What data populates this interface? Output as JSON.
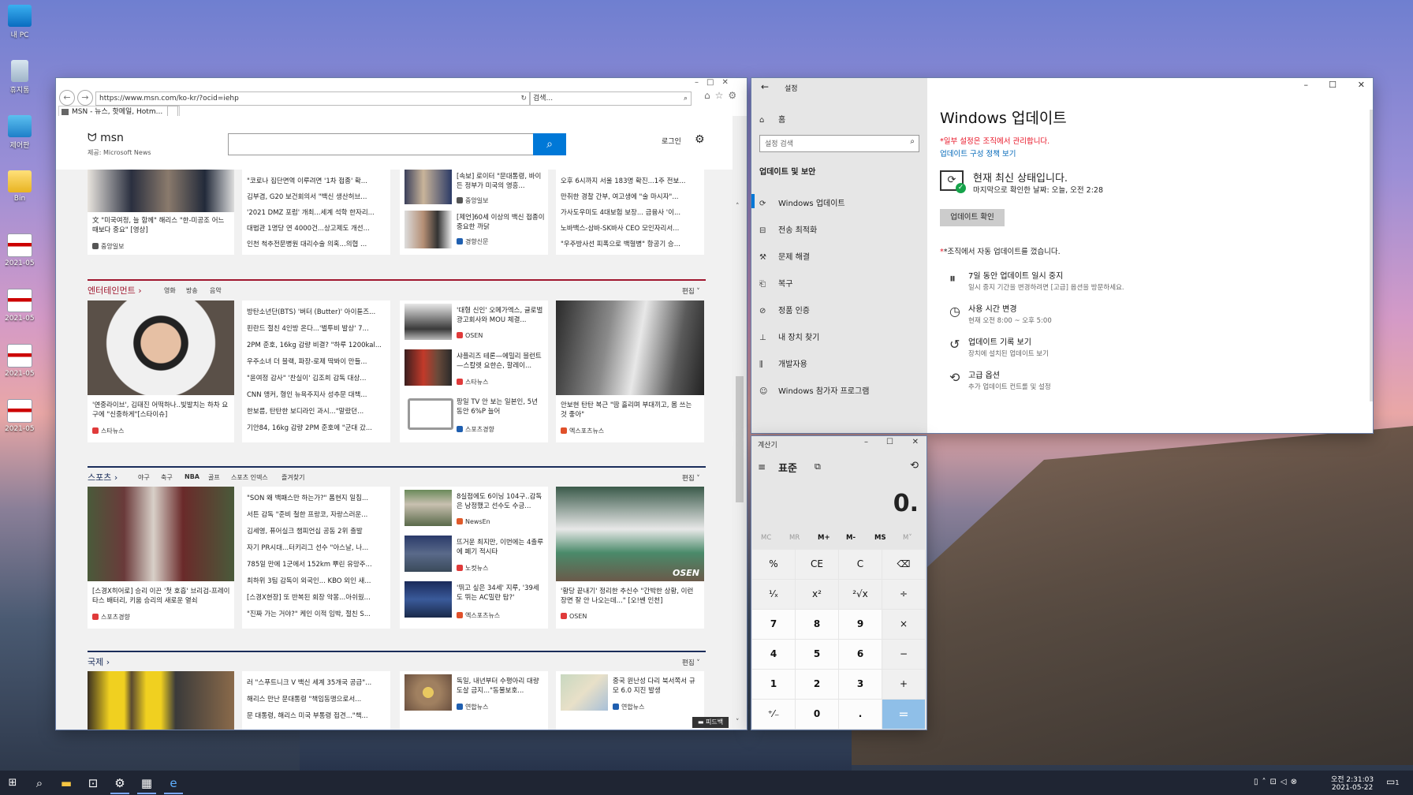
{
  "desktop": {
    "icons": [
      {
        "label": "내 PC"
      },
      {
        "label": "휴지통"
      },
      {
        "label": "제어판"
      },
      {
        "label": "Bin"
      },
      {
        "label": "2021-05-2..."
      },
      {
        "label": "2021-05-2..."
      },
      {
        "label": "2021-05-2..."
      },
      {
        "label": "2021-05-2..."
      }
    ]
  },
  "ie": {
    "address": "https://www.msn.com/ko-kr/?ocid=iehp",
    "search_placeholder": "검색...",
    "tab_title": "MSN - 뉴스, 핫메일, Hotm...",
    "msn_logo": "msn",
    "msn_provider": "제공: Microsoft News",
    "login": "로그인",
    "feedback": "피드백",
    "top_block": {
      "left_card_text": "文 \"미국여정, 늘 함께\" 해리스 \"한-미공조 어느 때보다 중요\" [영상]",
      "left_card_src": "중앙일보",
      "list": [
        "\"코로나 집단면역 이루려면 '1차 접종' 확...",
        "김부겸, G20 보건회의서 \"백신 생산허브...",
        "'2021 DMZ 포럼' 개최...세계 석학 한자리...",
        "대법관 1명당 연 4000건...상고제도 개선...",
        "인천 척추전문병원 대리수술 의혹...의협 ..."
      ],
      "mid": [
        {
          "title": "[속보] 로이터 \"문대통령, 바이든 정부가 미국의 영흥...",
          "src": "중앙일보"
        },
        {
          "title": "[제언]60세 이상의 백신 접종이 중요한 까닭",
          "src": "경향신문"
        }
      ],
      "right_list": [
        "오후 6시까지 서울 183명 확진...1주 전보...",
        "만취한 경찰 간부, 여고생에 \"술 마시자\"...",
        "가사도우미도 4대보험 보장... 금융사 '이...",
        "노바백스-삼바-SK바사 CEO 모인자리서...",
        "\"우주방사선 피폭으로 백혈병\" 항공기 승..."
      ]
    },
    "ent": {
      "title": "엔터테인먼트",
      "subs": [
        "영화",
        "방송",
        "음악"
      ],
      "edit": "편집",
      "left_text": "'연중라이브', 김태진 어떡하나..빛발치는 하차 요구에 \"신중하게\"[스타이슈]",
      "left_src": "스타뉴스",
      "list": [
        "방탄소년단(BTS) '버터 (Butter)' 아이튠즈...",
        "핀란드 절친 4인방 온다...'벌투비 발상' 7...",
        "2PM 준호, 16kg 감량 비결? \"하루 1200kal...",
        "우주소녀 더 블랙, 파장-로제 딱봐이 만들...",
        "\"윤여정 감사\" '찬실이' 김조희 감독 대상...",
        "CNN 앵커, 형인 뉴욕주지사 성추문 대책...",
        "한보름, 탄탄한 보디라인 과시...\"말랐던...",
        "기안84, 16kg 감량 2PM 준호에 \"군대 갔..."
      ],
      "mid": [
        {
          "title": "'대형 신인' 오메가엑스, 글로벌 광고회사와 MOU 체결...",
          "src": "OSEN"
        },
        {
          "title": "샤플리즈 테론—에밀리 블런트—스칼렛 요한슨, 할레이...",
          "src": "스타뉴스"
        },
        {
          "title": "팡일 TV 안 보는 일본인, 5년 동안 6%P 늘어",
          "src": "스포츠경향"
        }
      ],
      "right_text": "안보현 탄탄 복근 \"땀 흘리며 부대끼고, 몸 쓰는 것 좋아\"",
      "right_src": "엑스포츠뉴스"
    },
    "sports": {
      "title": "스포츠",
      "subs": [
        "야구",
        "축구",
        "NBA",
        "골프",
        "스포츠 인덱스",
        "즐겨찾기"
      ],
      "edit": "편집",
      "left_text": "[스경X히어로] 승리 이끈 '첫 호흡' 브리검-프레이타스 배터리, 키움 승리의 새로운 열쇠",
      "left_src": "스포츠경향",
      "list": [
        "\"SON 왜 백패스만 하는가?\" 폼현지 일침...",
        "서튼 감독 \"준비 철한 프랑코, 자랑스러운...",
        "김세영, 퓨어실크 챔피언십 공동 2위 출발",
        "자기 PR시대...터키리그 선수 \"아스날, 나...",
        "785일 만에 1군에서 152km 뿌린 유망주...",
        "최하위 3팀 감독이 외국인... KBO 외인 새...",
        "[스경X현장] 또 반복된 회장 악몽...아쉬웠...",
        "\"진짜 가는 거야?\" 케인 이적 임박, 절친 S..."
      ],
      "mid": [
        {
          "title": "8실점에도 6이닝 104구..감독은 낭정했고 선수도 수긍...",
          "src": "NewsEn"
        },
        {
          "title": "뜨거운 최지만, 이번에는 4출루에 페기 적시타",
          "src": "노컷뉴스"
        },
        {
          "title": "'뛰고 싶은 34세' 지루, '39세도 뛰는 AC밀란 탐?'",
          "src": "엑스포츠뉴스"
        }
      ],
      "right_text": "'황당 끝내기' 정리한 추신수 \"간박한 상황, 이런 장면 잘 안 나오는데...\" [오!쎈 인천]",
      "right_src": "OSEN",
      "right_img_label": "OSEN"
    },
    "world": {
      "title": "국제",
      "edit": "편집",
      "list": [
        "러 \"스푸트니크 V 백신 세계 35개국 공급\"...",
        "해리스 만난 문대통령 \"책임동맹으로서...",
        "문 대통령, 해리스 미국 부통령 접견...\"책..."
      ],
      "mid": [
        {
          "title": "독일, 내년부터 수평아리 대량도살 금지...\"동물보호...",
          "src": "연합뉴스"
        }
      ],
      "right": {
        "title": "중국 윈난성 다리 북서쪽서 규모 6.0 지진 발생",
        "src": "연합뉴스"
      }
    }
  },
  "settings": {
    "header": "설정",
    "home": "홈",
    "search_placeholder": "설정 검색",
    "section": "업데이트 및 보안",
    "nav": [
      "Windows 업데이트",
      "전송 최적화",
      "문제 해결",
      "복구",
      "정품 인증",
      "내 장치 찾기",
      "개발자용",
      "Windows 참가자 프로그램"
    ],
    "title": "Windows 업데이트",
    "managed_note": "*일부 설정은 조직에서 관리합니다.",
    "policy_link": "업데이트 구성 정책 보기",
    "status_title": "현재 최신 상태입니다.",
    "status_sub": "마지막으로 확인한 날짜: 오늘, 오전 2:28",
    "check_button": "업데이트 확인",
    "org_note": "*조직에서 자동 업데이트를 껐습니다.",
    "options": [
      {
        "title": "7일 동안 업데이트 일시 중지",
        "sub": "일시 중지 기간을 변경하려면 [고급] 옵션을 방문하세요."
      },
      {
        "title": "사용 시간 변경",
        "sub": "현재 오전 8:00 ~ 오후 5:00"
      },
      {
        "title": "업데이트 기록 보기",
        "sub": "장치에 설치된 업데이트 보기"
      },
      {
        "title": "고급 옵션",
        "sub": "추가 업데이트 컨트롤 및 설정"
      }
    ]
  },
  "calculator": {
    "title": "계산기",
    "mode": "표준",
    "display": "0.",
    "memory": [
      "MC",
      "MR",
      "M+",
      "M-",
      "MS",
      "M˅"
    ],
    "keys": [
      [
        "%",
        "CE",
        "C",
        "⌫"
      ],
      [
        "¹⁄ₓ",
        "x²",
        "²√x",
        "÷"
      ],
      [
        "7",
        "8",
        "9",
        "×"
      ],
      [
        "4",
        "5",
        "6",
        "−"
      ],
      [
        "1",
        "2",
        "3",
        "+"
      ],
      [
        "⁺⁄₋",
        "0",
        ".",
        "="
      ]
    ]
  },
  "taskbar": {
    "time": "오전 2:31:03",
    "date": "2021-05-22",
    "notif_count": "1"
  },
  "colors": {
    "accent": "#0078d7",
    "ent_rule": "#a0172e",
    "sports_rule": "#1a2d5a",
    "world_rule": "#1a2d5a",
    "warning_red": "#e81123"
  }
}
